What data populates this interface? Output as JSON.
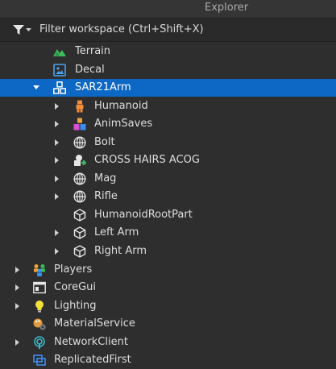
{
  "panel": {
    "title": "Explorer"
  },
  "filter": {
    "placeholder": "Filter workspace (Ctrl+Shift+X)"
  },
  "tree": {
    "terrain": "Terrain",
    "decal": "Decal",
    "model": "SAR21Arm",
    "humanoid": "Humanoid",
    "animsaves": "AnimSaves",
    "bolt": "Bolt",
    "crosshairs": "CROSS HAIRS ACOG",
    "mag": "Mag",
    "rifle": "Rifle",
    "rootpart": "HumanoidRootPart",
    "leftarm": "Left Arm",
    "rightarm": "Right Arm",
    "players": "Players",
    "coregui": "CoreGui",
    "lighting": "Lighting",
    "materialservice": "MaterialService",
    "networkclient": "NetworkClient",
    "replicatedfirst": "ReplicatedFirst"
  },
  "colors": {
    "selection": "#0c67c5",
    "background": "#2e2e2e"
  }
}
